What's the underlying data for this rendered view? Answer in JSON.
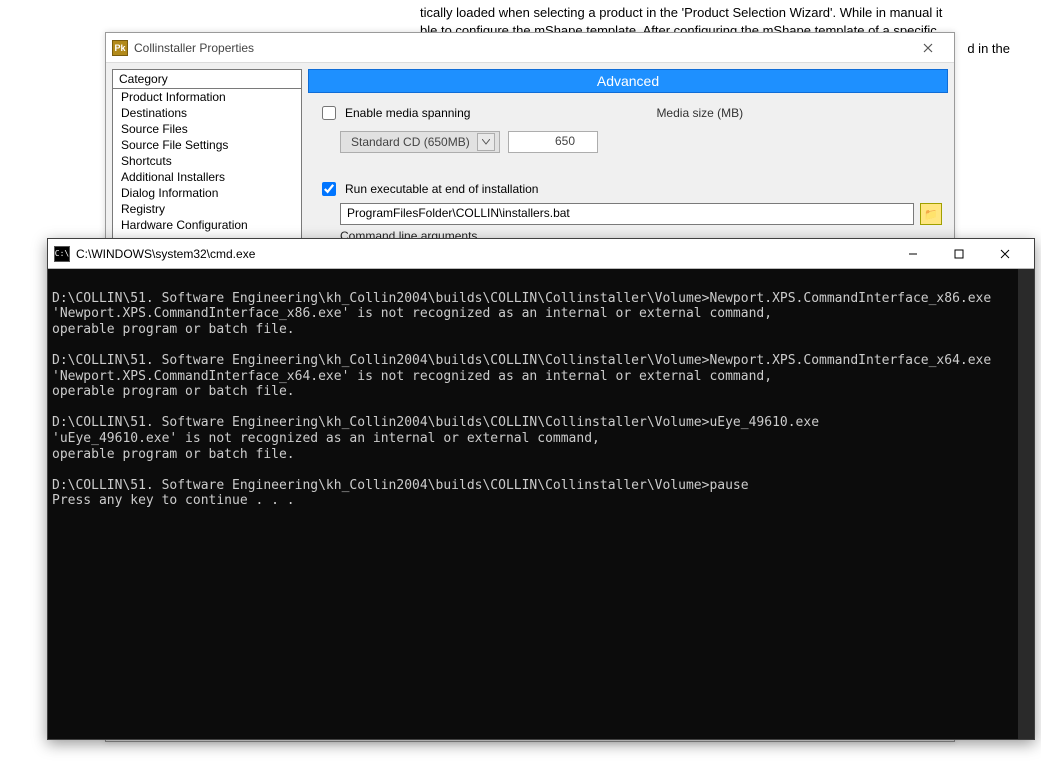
{
  "bg_doc": {
    "line1": "tically loaded when selecting a product in the 'Product Selection Wizard'. While in manual it",
    "line2_a": "ble to configure the ",
    "line2_b": "mShape",
    "line2_c": " template. After configuring the ",
    "line2_d": "mShape",
    "line2_e": " template of a specific",
    "line3": "d in the"
  },
  "propwin": {
    "title": "Collinstaller Properties",
    "advanced_banner": "Advanced",
    "categories_header": "Category",
    "categories": [
      "Product Information",
      "Destinations",
      "Source Files",
      "Source File Settings",
      "Shortcuts",
      "Additional Installers",
      "Dialog Information",
      "Registry",
      "Hardware Configuration"
    ],
    "media": {
      "checkbox_label": "Enable media spanning",
      "size_label": "Media size (MB)",
      "combo_value": "Standard CD (650MB)",
      "size_value": "650"
    },
    "runexe": {
      "checkbox_label": "Run executable at end of installation",
      "path_value": "ProgramFilesFolder\\COLLIN\\installers.bat",
      "args_label": "Command line arguments"
    }
  },
  "cmd": {
    "title": "C:\\WINDOWS\\system32\\cmd.exe",
    "prompt": "D:\\COLLIN\\51. Software Engineering\\kh_Collin2004\\builds\\COLLIN\\Collinstaller\\Volume>",
    "block1_cmd": "Newport.XPS.CommandInterface_x86.exe",
    "block1_err1": "'Newport.XPS.CommandInterface_x86.exe' is not recognized as an internal or external command,",
    "block1_err2": "operable program or batch file.",
    "block2_cmd": "Newport.XPS.CommandInterface_x64.exe",
    "block2_err1": "'Newport.XPS.CommandInterface_x64.exe' is not recognized as an internal or external command,",
    "block2_err2": "operable program or batch file.",
    "block3_cmd": "uEye_49610.exe",
    "block3_err1": "'uEye_49610.exe' is not recognized as an internal or external command,",
    "block3_err2": "operable program or batch file.",
    "block4_cmd": "pause",
    "block4_msg": "Press any key to continue . . ."
  }
}
